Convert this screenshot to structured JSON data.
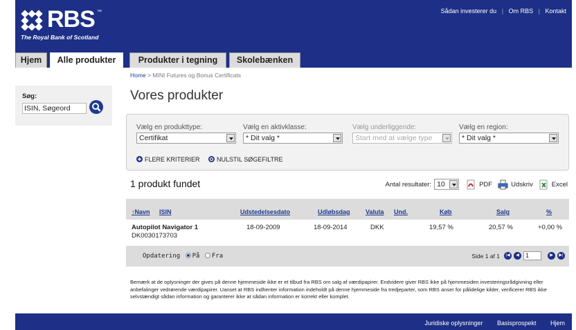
{
  "brand": {
    "logo_text": "RBS",
    "tm": "™",
    "subtitle": "The Royal Bank of Scotland"
  },
  "top_links": [
    "Sådan investerer du",
    "Om RBS",
    "Kontakt"
  ],
  "tabs": [
    {
      "label": "Hjem",
      "active": false
    },
    {
      "label": "Alle produkter",
      "active": true
    },
    {
      "label": "Produkter i tegning",
      "active": false
    },
    {
      "label": "Skolebænken",
      "active": false
    }
  ],
  "search": {
    "label": "Søg:",
    "value": "ISIN, Søgeord"
  },
  "breadcrumb": {
    "home": "Home",
    "separator": ">",
    "current": "MINI Futures og Bonus Certificats"
  },
  "page_title": "Vores produkter",
  "filters": [
    {
      "label": "Vælg en produkttype:",
      "value": "Certifikat",
      "disabled": false
    },
    {
      "label": "Vælg en aktivklasse:",
      "value": "* Dit valg *",
      "disabled": false
    },
    {
      "label": "Vælg underliggende:",
      "value": "Start med at vælge type",
      "disabled": true
    },
    {
      "label": "Vælg en region:",
      "value": "* Dit valg *",
      "disabled": false
    }
  ],
  "filter_links": {
    "more": "FLERE KRITERIER",
    "reset": "NULSTIL SØGEFILTRE"
  },
  "results": {
    "found_text": "1 produkt fundet",
    "count_label": "Antal resultater:",
    "count_value": "10",
    "pdf": "PDF",
    "print": "Udskriv",
    "excel": "Excel"
  },
  "table": {
    "columns": {
      "name": "Navn",
      "sort_arrow": "↑",
      "isin": "ISIN",
      "issue_date": "Udstedelsesdato",
      "expiry": "Udløbsdag",
      "currency": "Valuta",
      "und": "Und.",
      "buy": "Køb",
      "sell": "Salg",
      "pct": "%"
    },
    "rows": [
      {
        "name": "Autopilot Navigator 1",
        "isin": "DK0030173703",
        "issue_date": "18-09-2009",
        "expiry": "18-09-2014",
        "currency": "DKK",
        "und": "",
        "buy": "19,57 %",
        "sell": "20,57 %",
        "pct": "+0,00 %"
      }
    ]
  },
  "footer_bar": {
    "update_label": "Opdatering",
    "on": "På",
    "off": "Fra",
    "page_text": "Side 1 af 1",
    "page_value": "1"
  },
  "disclaimer": "Bemærk at de oplysninger der gives på denne hjemmeside ikke er et tilbud fra RBS om salg af værdipapirer. Endvidere giver RBS ikke på hjemmesiden investeringsrådgivning eller anbefalinger vedrørende værdipapirer. Uanset at RBS indhenter information indeholdt på denne hjemmeside fra tredjeparter, som RBS anser for pålidelige kilder, verificerer RBS ikke selvstændigt sådan information og garanterer ikke at sådan information er korrekt eller komplet.",
  "footer_links": [
    "Juridiske oplysninger",
    "Basisprospekt",
    "Hjem"
  ],
  "colors": {
    "brand_blue": "#1d2f86",
    "link_blue": "#1d3b8f",
    "header_grey": "#dcdcdc"
  },
  "icons": {
    "search": "search-icon",
    "pdf": "pdf-icon",
    "print": "print-icon",
    "excel": "excel-icon"
  }
}
